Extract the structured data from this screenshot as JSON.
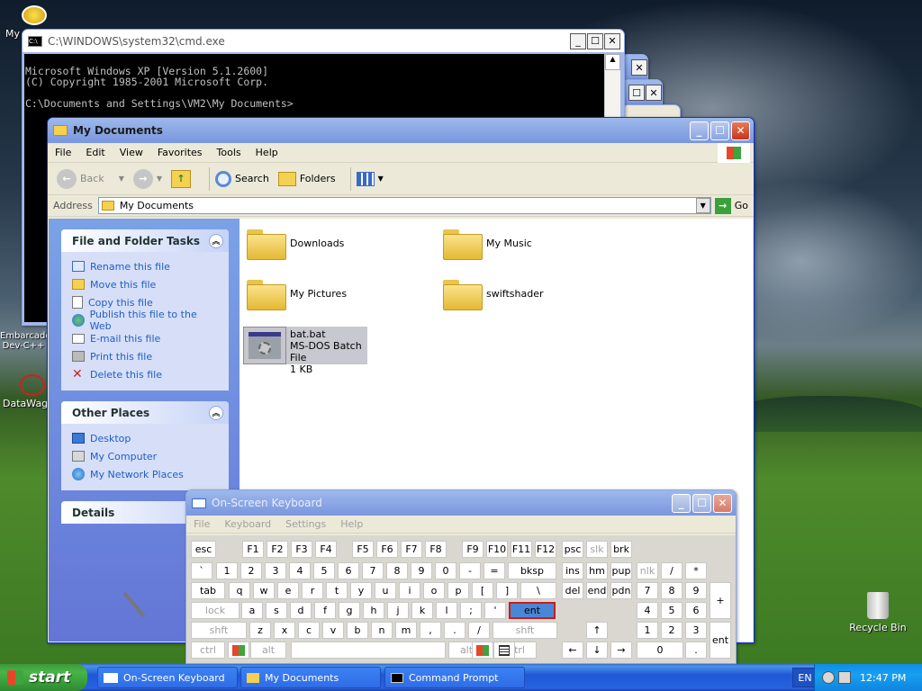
{
  "desktop": {
    "icons": [
      {
        "label": "My"
      },
      {
        "label": "Embarcadero Dev-C++"
      },
      {
        "label": "DataWago"
      },
      {
        "label": "Recycle Bin"
      }
    ]
  },
  "cmd_window": {
    "title": "C:\\WINDOWS\\system32\\cmd.exe",
    "lines": [
      "Microsoft Windows XP [Version 5.1.2600]",
      "(C) Copyright 1985-2001 Microsoft Corp.",
      "",
      "C:\\Documents and Settings\\VM2\\My Documents>"
    ]
  },
  "explorer": {
    "title": "My Documents",
    "menu": [
      "File",
      "Edit",
      "View",
      "Favorites",
      "Tools",
      "Help"
    ],
    "toolbar": {
      "back": "Back",
      "search": "Search",
      "folders": "Folders"
    },
    "address": {
      "label": "Address",
      "value": "My Documents",
      "go": "Go"
    },
    "file_tasks": {
      "title": "File and Folder Tasks",
      "items": [
        "Rename this file",
        "Move this file",
        "Copy this file",
        "Publish this file to the Web",
        "E-mail this file",
        "Print this file",
        "Delete this file"
      ]
    },
    "other_places": {
      "title": "Other Places",
      "items": [
        "Desktop",
        "My Computer",
        "My Network Places"
      ]
    },
    "details": {
      "title": "Details"
    },
    "items": [
      {
        "name": "Downloads"
      },
      {
        "name": "My Music"
      },
      {
        "name": "My Pictures"
      },
      {
        "name": "swiftshader"
      },
      {
        "name": "bat.bat",
        "type": "MS-DOS Batch File",
        "size": "1 KB"
      }
    ]
  },
  "osk": {
    "title": "On-Screen Keyboard",
    "menu": [
      "File",
      "Keyboard",
      "Settings",
      "Help"
    ],
    "highlight_key": "ent",
    "rows": [
      [
        "esc",
        "F1",
        "F2",
        "F3",
        "F4",
        "F5",
        "F6",
        "F7",
        "F8",
        "F9",
        "F10",
        "F11",
        "F12",
        "psc",
        "slk",
        "brk"
      ],
      [
        "`",
        "1",
        "2",
        "3",
        "4",
        "5",
        "6",
        "7",
        "8",
        "9",
        "0",
        "-",
        "=",
        "bksp",
        "ins",
        "hm",
        "pup",
        "nlk",
        "/",
        "*",
        "-"
      ],
      [
        "tab",
        "q",
        "w",
        "e",
        "r",
        "t",
        "y",
        "u",
        "i",
        "o",
        "p",
        "[",
        "]",
        "\\",
        "del",
        "end",
        "pdn",
        "7",
        "8",
        "9",
        "+"
      ],
      [
        "lock",
        "a",
        "s",
        "d",
        "f",
        "g",
        "h",
        "j",
        "k",
        "l",
        ";",
        "'",
        "ent",
        "4",
        "5",
        "6"
      ],
      [
        "shft",
        "z",
        "x",
        "c",
        "v",
        "b",
        "n",
        "m",
        ",",
        ".",
        "/",
        "shft",
        "↑",
        "1",
        "2",
        "3",
        "ent"
      ],
      [
        "ctrl",
        "alt",
        "",
        "alt",
        "ctrl",
        "←",
        "↓",
        "→",
        "0",
        "."
      ]
    ]
  },
  "taskbar": {
    "start": "start",
    "items": [
      "On-Screen Keyboard",
      "My Documents",
      "Command Prompt"
    ],
    "lang": "EN",
    "time": "12:47 PM"
  }
}
